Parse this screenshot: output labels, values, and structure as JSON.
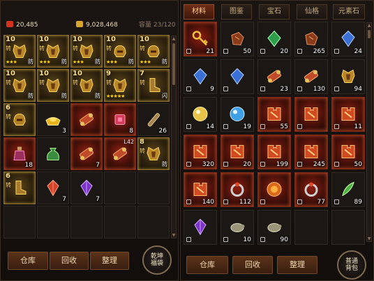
{
  "left_panel": {
    "ingots": "20,485",
    "gold": "9,028,468",
    "capacity_label": "容量",
    "capacity": "23/120",
    "buttons": {
      "warehouse": "仓库",
      "recycle": "回收",
      "sort": "整理"
    },
    "round_button": "乾坤福袋",
    "items": [
      {
        "icon": "armor",
        "quality": "gold",
        "level": "10",
        "zhuan": "转",
        "stars": "★★★",
        "fang": "防"
      },
      {
        "icon": "armor",
        "quality": "gold",
        "level": "10",
        "zhuan": "转",
        "stars": "★★★",
        "fang": "防"
      },
      {
        "icon": "armor",
        "quality": "gold",
        "level": "10",
        "zhuan": "转",
        "stars": "★★★",
        "fang": "防"
      },
      {
        "icon": "helmet",
        "quality": "gold",
        "level": "10",
        "zhuan": "转",
        "stars": "★★★",
        "fang": "防"
      },
      {
        "icon": "helmet",
        "quality": "gold",
        "level": "10",
        "zhuan": "转",
        "stars": "★★★",
        "fang": "防"
      },
      {
        "icon": "armor",
        "quality": "gold",
        "level": "10",
        "zhuan": "转",
        "stars": "",
        "fang": "防"
      },
      {
        "icon": "armor",
        "quality": "gold",
        "level": "10",
        "zhuan": "转",
        "stars": "",
        "fang": "防"
      },
      {
        "icon": "armor",
        "quality": "gold",
        "level": "10",
        "zhuan": "转",
        "stars": "",
        "fang": "防"
      },
      {
        "icon": "armor",
        "quality": "gold",
        "level": "9",
        "zhuan": "转",
        "stars": "★★★★★",
        "fang": ""
      },
      {
        "icon": "boot",
        "quality": "gold",
        "level": "7",
        "zhuan": "转",
        "stars": "",
        "fang": "闪"
      },
      {
        "icon": "helmet",
        "quality": "gold",
        "level": "6",
        "zhuan": "转",
        "stars": "",
        "fang": ""
      },
      {
        "icon": "ingot",
        "quality": "dark",
        "qty": "3"
      },
      {
        "icon": "scroll",
        "quality": "red"
      },
      {
        "icon": "crystal",
        "quality": "red",
        "qty": "8"
      },
      {
        "icon": "rod",
        "quality": "dark",
        "qty": "26"
      },
      {
        "icon": "potion",
        "quality": "red",
        "qty": "18"
      },
      {
        "icon": "bag",
        "quality": "dark"
      },
      {
        "icon": "scroll",
        "quality": "red",
        "qty": "7"
      },
      {
        "icon": "scroll",
        "quality": "red",
        "plv": "L42"
      },
      {
        "icon": "armor",
        "quality": "gold",
        "level": "8",
        "zhuan": "转",
        "stars": "",
        "fang": "防"
      },
      {
        "icon": "boot",
        "quality": "gold",
        "level": "6",
        "zhuan": "转",
        "stars": "",
        "fang": ""
      },
      {
        "icon": "gem-red",
        "quality": "dark",
        "qty": "7"
      },
      {
        "icon": "gem-purple",
        "quality": "dark",
        "qty": "7"
      },
      {},
      {},
      {},
      {},
      {},
      {},
      {}
    ]
  },
  "right_panel": {
    "tabs": [
      "材料",
      "图鉴",
      "宝石",
      "仙格",
      "元素石"
    ],
    "buttons": {
      "warehouse": "仓库",
      "recycle": "回收",
      "sort": "整理"
    },
    "round_button": "普通背包",
    "items": [
      {
        "icon": "key",
        "quality": "red",
        "qty": "21"
      },
      {
        "icon": "ore",
        "quality": "dark",
        "qty": "50"
      },
      {
        "icon": "gem-green",
        "quality": "dark",
        "qty": "20"
      },
      {
        "icon": "ore",
        "quality": "dark",
        "qty": "265"
      },
      {
        "icon": "gem-blue",
        "quality": "dark",
        "qty": "24"
      },
      {
        "icon": "gem-blue",
        "quality": "dark",
        "qty": "9"
      },
      {
        "icon": "gem-blue",
        "quality": "dark",
        "qty": ""
      },
      {
        "icon": "scroll",
        "quality": "dark",
        "qty": "23"
      },
      {
        "icon": "scroll",
        "quality": "dark",
        "qty": "130"
      },
      {
        "icon": "armor",
        "quality": "dark",
        "qty": "94"
      },
      {
        "icon": "orb-gold",
        "quality": "dark",
        "qty": "14"
      },
      {
        "icon": "orb-blue",
        "quality": "dark",
        "qty": "19"
      },
      {
        "icon": "piece",
        "quality": "red",
        "qty": "55"
      },
      {
        "icon": "piece",
        "quality": "red",
        "qty": ""
      },
      {
        "icon": "piece",
        "quality": "red",
        "qty": "11"
      },
      {
        "icon": "piece",
        "quality": "red",
        "qty": "320"
      },
      {
        "icon": "piece",
        "quality": "red",
        "qty": "20"
      },
      {
        "icon": "piece",
        "quality": "red",
        "qty": "199"
      },
      {
        "icon": "piece",
        "quality": "red",
        "qty": "245"
      },
      {
        "icon": "piece",
        "quality": "red",
        "qty": "50"
      },
      {
        "icon": "piece",
        "quality": "red",
        "qty": "140"
      },
      {
        "icon": "ring",
        "quality": "red",
        "qty": "112"
      },
      {
        "icon": "orb-red",
        "quality": "red",
        "qty": ""
      },
      {
        "icon": "ring",
        "quality": "red",
        "qty": "77"
      },
      {
        "icon": "feather",
        "quality": "dark",
        "qty": "89"
      },
      {
        "icon": "gem-purple",
        "quality": "dark",
        "qty": ""
      },
      {
        "icon": "turtle",
        "quality": "dark",
        "qty": "10"
      },
      {
        "icon": "turtle",
        "quality": "dark",
        "qty": "90"
      },
      {},
      {}
    ]
  },
  "colors": {
    "red_glow": "#e0502a",
    "gold_border": "#b8942f",
    "tab_active": "#6d2d16",
    "button": "#4a2814"
  }
}
